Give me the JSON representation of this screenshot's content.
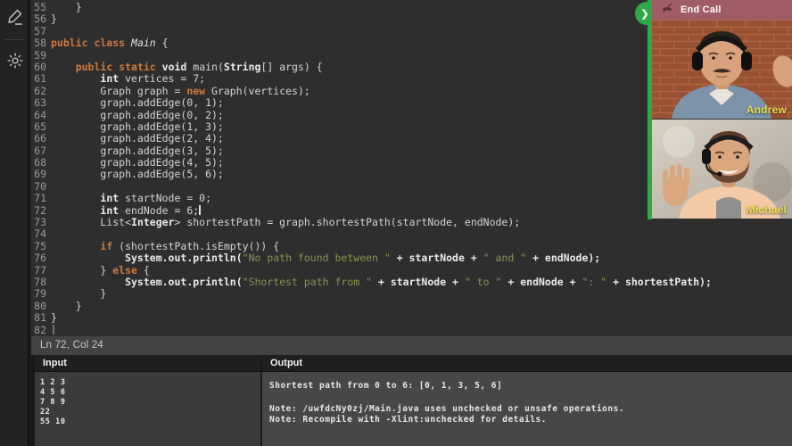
{
  "sidebar": {
    "icons": [
      {
        "name": "pencil-icon"
      },
      {
        "name": "brightness-icon"
      }
    ]
  },
  "editor": {
    "status": "Ln 72, Col 24",
    "cursor": {
      "line": 72,
      "col": 24
    },
    "lines": [
      {
        "n": 55,
        "t": [
          [
            "p",
            "    }"
          ]
        ]
      },
      {
        "n": 56,
        "t": [
          [
            "p",
            "}"
          ]
        ]
      },
      {
        "n": 57,
        "t": []
      },
      {
        "n": 58,
        "t": [
          [
            "k",
            "public class "
          ],
          [
            "c",
            "Main"
          ],
          [
            "p",
            " {"
          ]
        ]
      },
      {
        "n": 59,
        "t": []
      },
      {
        "n": 60,
        "t": [
          [
            "p",
            "    "
          ],
          [
            "k",
            "public static "
          ],
          [
            "t",
            "void"
          ],
          [
            "p",
            " main("
          ],
          [
            "t",
            "String"
          ],
          [
            "p",
            "[] args) {"
          ]
        ]
      },
      {
        "n": 61,
        "t": [
          [
            "p",
            "        "
          ],
          [
            "t",
            "int"
          ],
          [
            "p",
            " vertices = 7;"
          ]
        ]
      },
      {
        "n": 62,
        "t": [
          [
            "p",
            "        Graph graph = "
          ],
          [
            "k",
            "new"
          ],
          [
            "p",
            " Graph(vertices);"
          ]
        ]
      },
      {
        "n": 63,
        "t": [
          [
            "p",
            "        graph.addEdge(0, 1);"
          ]
        ]
      },
      {
        "n": 64,
        "t": [
          [
            "p",
            "        graph.addEdge(0, 2);"
          ]
        ]
      },
      {
        "n": 65,
        "t": [
          [
            "p",
            "        graph.addEdge(1, 3);"
          ]
        ]
      },
      {
        "n": 66,
        "t": [
          [
            "p",
            "        graph.addEdge(2, 4);"
          ]
        ]
      },
      {
        "n": 67,
        "t": [
          [
            "p",
            "        graph.addEdge(3, 5);"
          ]
        ]
      },
      {
        "n": 68,
        "t": [
          [
            "p",
            "        graph.addEdge(4, 5);"
          ]
        ]
      },
      {
        "n": 69,
        "t": [
          [
            "p",
            "        graph.addEdge(5, 6);"
          ]
        ]
      },
      {
        "n": 70,
        "t": []
      },
      {
        "n": 71,
        "t": [
          [
            "p",
            "        "
          ],
          [
            "t",
            "int"
          ],
          [
            "p",
            " startNode = 0;"
          ]
        ]
      },
      {
        "n": 72,
        "t": [
          [
            "p",
            "        "
          ],
          [
            "t",
            "int"
          ],
          [
            "p",
            " endNode = 6;"
          ]
        ],
        "cursor": true
      },
      {
        "n": 73,
        "t": [
          [
            "p",
            "        List<"
          ],
          [
            "t",
            "Integer"
          ],
          [
            "p",
            "> shortestPath = graph.shortestPath(startNode, endNode);"
          ]
        ]
      },
      {
        "n": 74,
        "t": []
      },
      {
        "n": 75,
        "t": [
          [
            "p",
            "        "
          ],
          [
            "k",
            "if"
          ],
          [
            "p",
            " (shortestPath.isEmpty()) {"
          ]
        ]
      },
      {
        "n": 76,
        "t": [
          [
            "b",
            "            System.out.println("
          ],
          [
            "s",
            "\"No path found between \""
          ],
          [
            "b",
            " + startNode + "
          ],
          [
            "s",
            "\" and \""
          ],
          [
            "b",
            " + endNode);"
          ]
        ]
      },
      {
        "n": 77,
        "t": [
          [
            "p",
            "        } "
          ],
          [
            "k",
            "else"
          ],
          [
            "p",
            " {"
          ]
        ]
      },
      {
        "n": 78,
        "t": [
          [
            "b",
            "            System.out.println("
          ],
          [
            "s",
            "\"Shortest path from \""
          ],
          [
            "b",
            " + startNode + "
          ],
          [
            "s",
            "\" to \""
          ],
          [
            "b",
            " + endNode + "
          ],
          [
            "s",
            "\": \""
          ],
          [
            "b",
            " + shortestPath);"
          ]
        ]
      },
      {
        "n": 79,
        "t": [
          [
            "p",
            "        }"
          ]
        ]
      },
      {
        "n": 80,
        "t": [
          [
            "p",
            "    }"
          ]
        ]
      },
      {
        "n": 81,
        "t": [
          [
            "p",
            "}"
          ]
        ]
      },
      {
        "n": 82,
        "t": [],
        "ghost": true
      }
    ]
  },
  "call_panel": {
    "end_call_label": "End Call",
    "collapse_chevron": "❯",
    "accent_green": "#2fa847",
    "end_call_bg": "#a05d66",
    "participants": [
      {
        "name": "Andrew"
      },
      {
        "name": "Michael"
      }
    ]
  },
  "io": {
    "input": {
      "title": "Input",
      "lines": [
        "1 2 3",
        "4 5 6",
        "7 8 9",
        "22",
        "55 10"
      ]
    },
    "output": {
      "title": "Output",
      "lines": [
        "Shortest path from 0 to 6: [0, 1, 3, 5, 6]",
        "",
        "Note: /uwfdcNy0zj/Main.java uses unchecked or unsafe operations.",
        "Note: Recompile with -Xlint:unchecked for details."
      ]
    }
  }
}
